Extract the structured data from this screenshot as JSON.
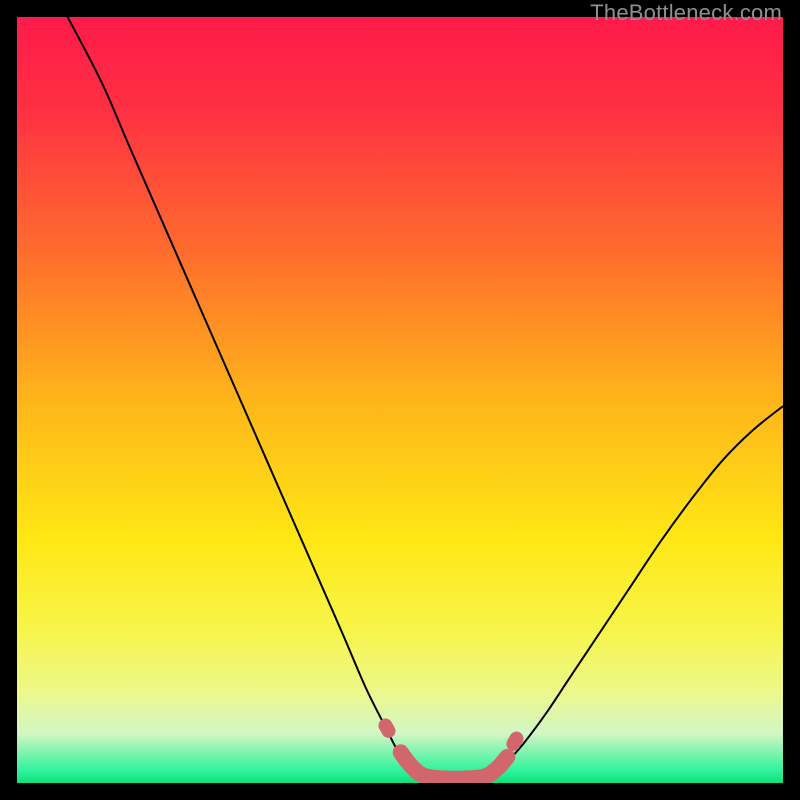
{
  "watermark": "TheBottleneck.com",
  "chart_data": {
    "type": "line",
    "title": "",
    "xlabel": "",
    "ylabel": "",
    "xlim": [
      0,
      1
    ],
    "ylim": [
      0,
      1
    ],
    "gradient_stops": [
      {
        "offset": 0.0,
        "color": "#ff1a4a"
      },
      {
        "offset": 0.12,
        "color": "#ff3042"
      },
      {
        "offset": 0.3,
        "color": "#ff6a2e"
      },
      {
        "offset": 0.5,
        "color": "#ffb51a"
      },
      {
        "offset": 0.68,
        "color": "#ffe714"
      },
      {
        "offset": 0.8,
        "color": "#f7f54a"
      },
      {
        "offset": 0.88,
        "color": "#ecf88a"
      },
      {
        "offset": 0.935,
        "color": "#d3f6c4"
      },
      {
        "offset": 0.985,
        "color": "#2df29a"
      },
      {
        "offset": 1.0,
        "color": "#0de07c"
      }
    ],
    "series": [
      {
        "name": "left-curve",
        "stroke": "#000000",
        "stroke_width": 2,
        "points": [
          {
            "x": 0.066,
            "y": 1.0
          },
          {
            "x": 0.09,
            "y": 0.955
          },
          {
            "x": 0.115,
            "y": 0.905
          },
          {
            "x": 0.145,
            "y": 0.835
          },
          {
            "x": 0.18,
            "y": 0.755
          },
          {
            "x": 0.215,
            "y": 0.675
          },
          {
            "x": 0.25,
            "y": 0.595
          },
          {
            "x": 0.285,
            "y": 0.515
          },
          {
            "x": 0.32,
            "y": 0.435
          },
          {
            "x": 0.355,
            "y": 0.355
          },
          {
            "x": 0.39,
            "y": 0.275
          },
          {
            "x": 0.425,
            "y": 0.195
          },
          {
            "x": 0.455,
            "y": 0.125
          },
          {
            "x": 0.48,
            "y": 0.075
          },
          {
            "x": 0.498,
            "y": 0.04
          },
          {
            "x": 0.51,
            "y": 0.024
          },
          {
            "x": 0.522,
            "y": 0.014
          }
        ]
      },
      {
        "name": "right-curve",
        "stroke": "#000000",
        "stroke_width": 2,
        "points": [
          {
            "x": 0.624,
            "y": 0.014
          },
          {
            "x": 0.64,
            "y": 0.028
          },
          {
            "x": 0.66,
            "y": 0.05
          },
          {
            "x": 0.69,
            "y": 0.09
          },
          {
            "x": 0.72,
            "y": 0.135
          },
          {
            "x": 0.76,
            "y": 0.195
          },
          {
            "x": 0.8,
            "y": 0.255
          },
          {
            "x": 0.84,
            "y": 0.315
          },
          {
            "x": 0.88,
            "y": 0.37
          },
          {
            "x": 0.92,
            "y": 0.42
          },
          {
            "x": 0.96,
            "y": 0.46
          },
          {
            "x": 1.0,
            "y": 0.492
          }
        ]
      },
      {
        "name": "bottom-highlight",
        "stroke": "#d1676c",
        "stroke_width": 16,
        "linecap": "round",
        "points": [
          {
            "x": 0.501,
            "y": 0.04
          },
          {
            "x": 0.514,
            "y": 0.023
          },
          {
            "x": 0.53,
            "y": 0.01
          },
          {
            "x": 0.555,
            "y": 0.006
          },
          {
            "x": 0.59,
            "y": 0.006
          },
          {
            "x": 0.612,
            "y": 0.009
          },
          {
            "x": 0.628,
            "y": 0.02
          },
          {
            "x": 0.64,
            "y": 0.034
          }
        ]
      },
      {
        "name": "bottom-highlight-dot1",
        "stroke": "#d1676c",
        "stroke_width": 14,
        "linecap": "round",
        "points": [
          {
            "x": 0.481,
            "y": 0.075
          },
          {
            "x": 0.485,
            "y": 0.068
          }
        ]
      },
      {
        "name": "bottom-highlight-dot2",
        "stroke": "#d1676c",
        "stroke_width": 14,
        "linecap": "round",
        "points": [
          {
            "x": 0.648,
            "y": 0.051
          },
          {
            "x": 0.652,
            "y": 0.058
          }
        ]
      }
    ]
  }
}
